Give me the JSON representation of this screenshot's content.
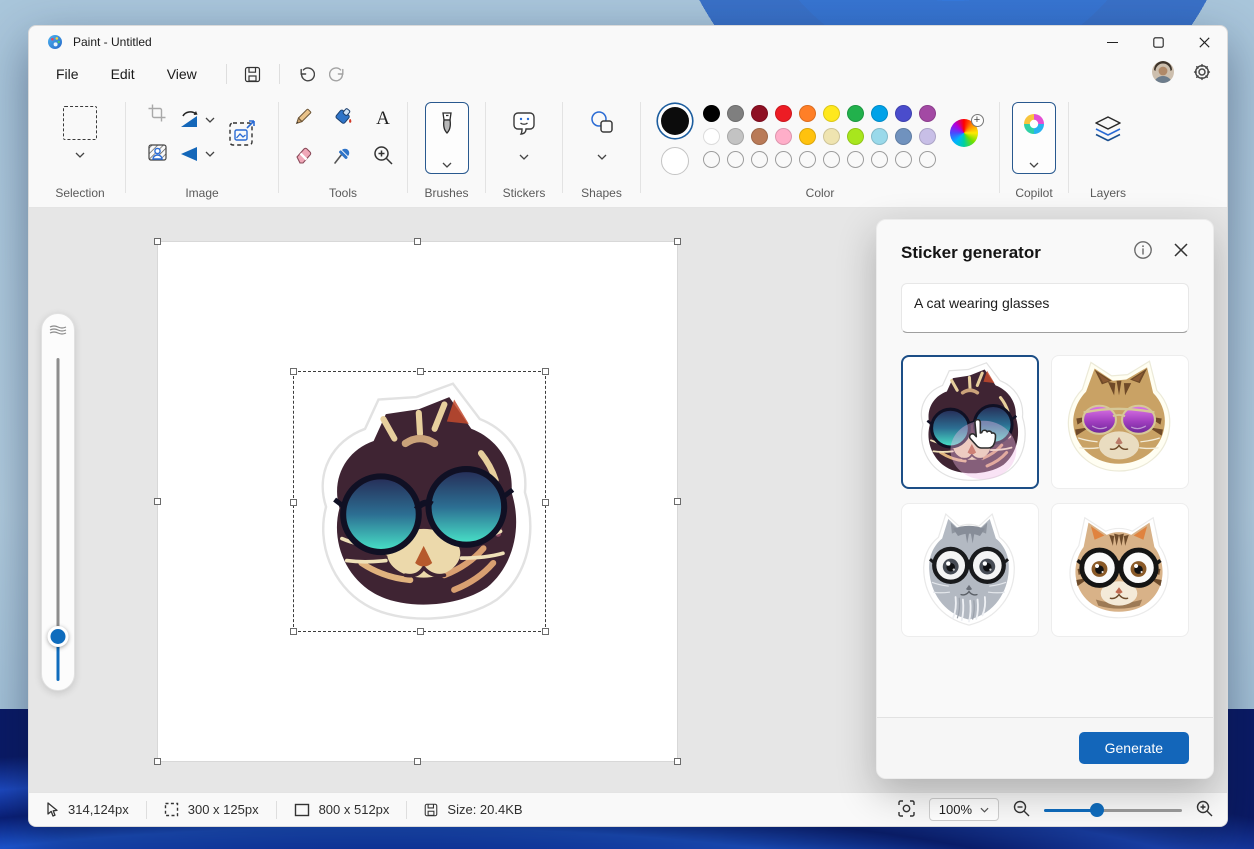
{
  "window": {
    "title": "Paint - Untitled"
  },
  "menu": {
    "items": [
      "File",
      "Edit",
      "View"
    ]
  },
  "ribbon": {
    "groups": {
      "selection": "Selection",
      "image": "Image",
      "tools": "Tools",
      "brushes": "Brushes",
      "stickers": "Stickers",
      "shapes": "Shapes",
      "color": "Color",
      "copilot": "Copilot",
      "layers": "Layers"
    }
  },
  "colors": {
    "foreground": "#0c0c0c",
    "background": "#ffffff",
    "row1": [
      "#000000",
      "#7f7f7f",
      "#8e1023",
      "#ed1c24",
      "#ff7f27",
      "#ffe81d",
      "#22b14c",
      "#00a2e8",
      "#4a4ccc",
      "#a349a4"
    ],
    "row2": [
      "#ffffff",
      "#c3c3c3",
      "#b97a57",
      "#ffaec9",
      "#ffc20e",
      "#efe4b0",
      "#a8e61d",
      "#99d9ea",
      "#7092be",
      "#c8bfe7"
    ],
    "empty_count": 10
  },
  "panel": {
    "title": "Sticker generator",
    "prompt": "A cat wearing glasses",
    "generate_label": "Generate"
  },
  "statusbar": {
    "cursor_position": "314,124px",
    "selection_size": "300 x 125px",
    "canvas_size": "800 x 512px",
    "file_size": "Size: 20.4KB",
    "zoom_level": "100%"
  },
  "accent": {
    "blue": "#1366ba",
    "slider_blue": "#0f6cbd"
  }
}
